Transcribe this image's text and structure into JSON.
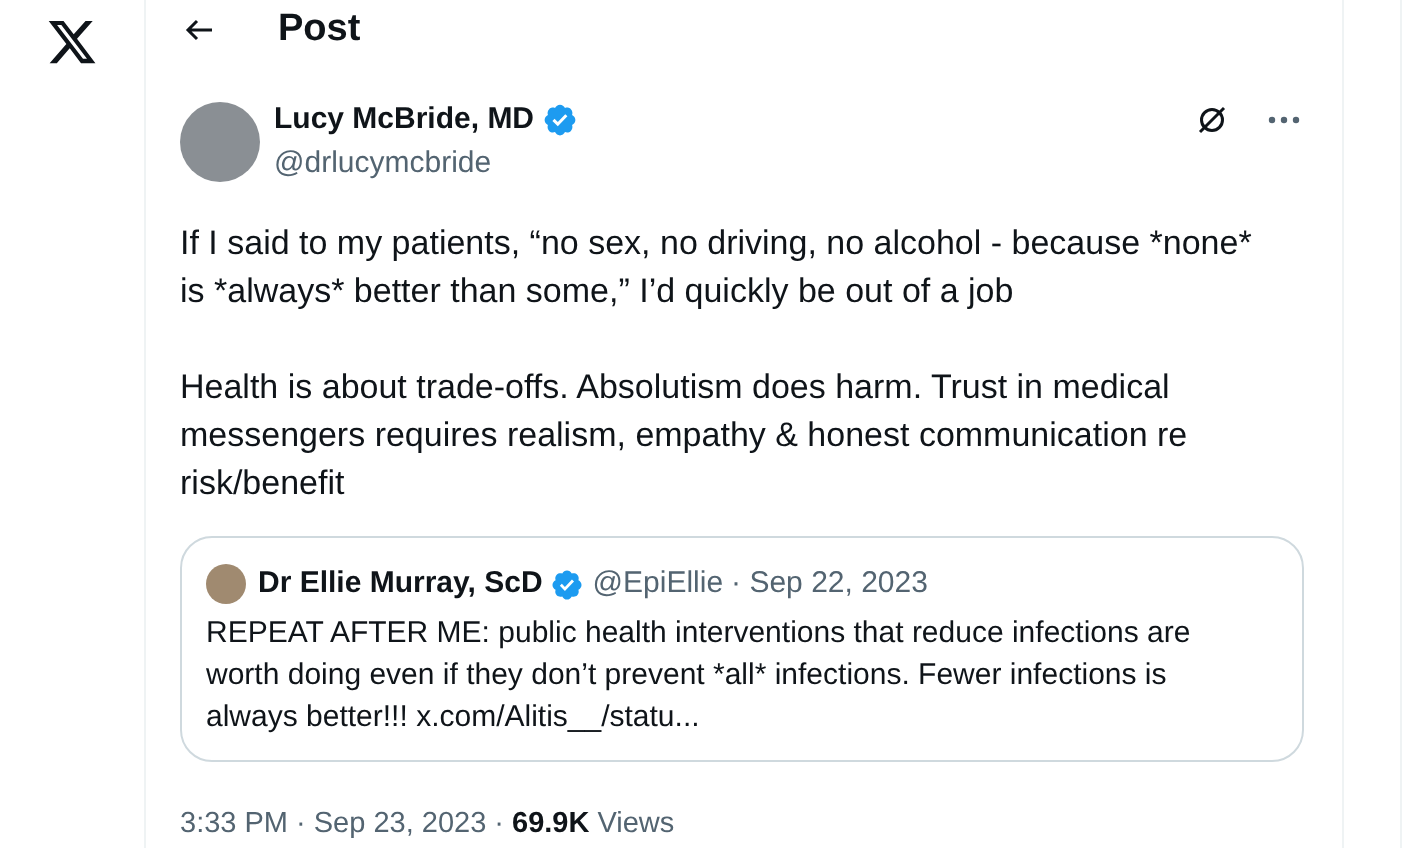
{
  "header": {
    "title": "Post"
  },
  "post": {
    "author": "Lucy McBride, MD",
    "verified": true,
    "handle": "@drlucymcbride",
    "paragraphs": [
      "If I said to my patients, “no sex, no driving, no alcohol - because *none* is *always* better than some,” I’d quickly be out of a job",
      "Health is about trade-offs. Absolutism does harm. Trust in medical messengers requires realism, empathy & honest communication re risk/benefit"
    ],
    "quote": {
      "author": "Dr Ellie Murray, ScD",
      "verified": true,
      "handle": "@EpiEllie",
      "date": "· Sep 22, 2023",
      "text": "REPEAT AFTER ME: public health interventions that reduce infections are worth doing even if they don’t prevent *all* infections. Fewer infections is always better!!!",
      "link": "x.com/Alitis__/statu..."
    },
    "time": "3:33 PM · Sep 23, 2023 ·",
    "views_count": "69.9K",
    "views_label": "Views"
  }
}
